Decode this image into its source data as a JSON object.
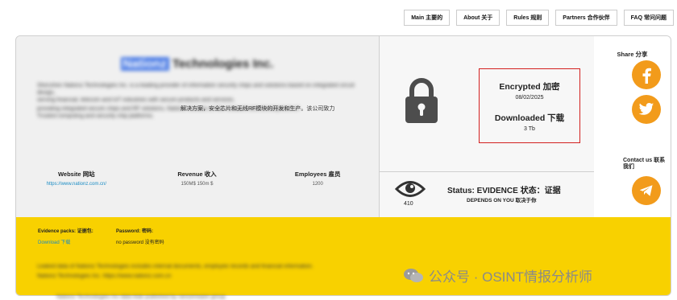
{
  "nav": {
    "items": [
      "Main 主要的",
      "About 关于",
      "Rules 规则",
      "Partners 合作伙伴",
      "FAQ 常问问题"
    ]
  },
  "company": {
    "name_highlight": "Nationz",
    "name_rest": "Technologies Inc.",
    "description_line1": "Shenzhen Nationz Technologies Inc. is a leading provider of information security chips and solutions based on integrated circuit design,",
    "description_line2": "serving financial, telecom and IoT industries with secure products and services.",
    "description_line3": "providing integrated secure chips and RF solutions, Nationz focuses on the research and development of",
    "description_tail": "解决方案，安全芯片和无线RF模块的开发和生产。该公司致力",
    "description_line4": "Trusted computing and security chip platforms."
  },
  "stats": {
    "website_label": "Website 网站",
    "website_value": "https://www.nationz.com.cn/",
    "revenue_label": "Revenue 收入",
    "revenue_value": "150M$ 150m $",
    "employees_label": "Employees 雇员",
    "employees_value": "1200"
  },
  "encryption": {
    "encrypted_label": "Encrypted 加密",
    "encrypted_date": "08/02/2025",
    "downloaded_label": "Downloaded 下载",
    "downloaded_size": "3 Tb"
  },
  "status": {
    "views": "410",
    "label": "Status: EVIDENCE 状态：证据",
    "sub": "DEPENDS ON YOU 取决于你"
  },
  "sidebar": {
    "share_label": "Share 分享",
    "contact_label": "Contact us 联系我们"
  },
  "footer": {
    "evidence_label": "Evidence packs: 证据包:",
    "download_link": "Download 下载",
    "password_label": "Password: 密码:",
    "password_value": "no password 没有密码",
    "blur_line1": "Leaked data of Nationz Technologies includes internal documents, employee records and financial information.",
    "blur_line2": "Nationz Technologies Inc. https://www.nationz.com.cn"
  },
  "watermark": "公众号 · OSINT情报分析师",
  "bottom_text": "Nationz Technologies Inc data leak published by ransomware group",
  "colors": {
    "accent_orange": "#f29b1b",
    "footer_yellow": "#f8d100",
    "frame_red": "#d3201f",
    "link_blue": "#1a8cc4"
  },
  "icons": [
    "lock-icon",
    "eye-icon",
    "facebook-icon",
    "twitter-icon",
    "telegram-icon",
    "wechat-icon"
  ]
}
